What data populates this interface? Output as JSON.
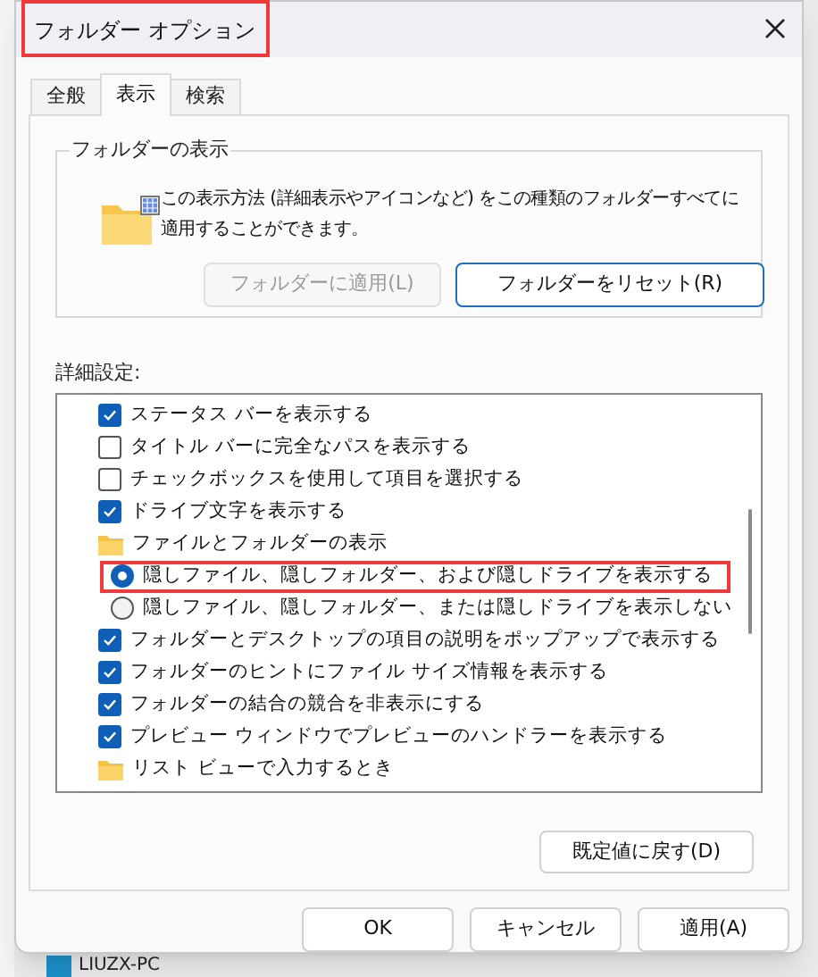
{
  "window": {
    "title": "フォルダー オプション"
  },
  "tabs": [
    {
      "label": "全般",
      "selected": false
    },
    {
      "label": "表示",
      "selected": true
    },
    {
      "label": "検索",
      "selected": false
    }
  ],
  "folder_views": {
    "title": "フォルダーの表示",
    "description": "この表示方法 (詳細表示やアイコンなど) をこの種類のフォルダーすべてに適用することができます。",
    "buttons": [
      {
        "label": "フォルダーに適用(L)",
        "disabled": true
      },
      {
        "label": "フォルダーをリセット(R)",
        "disabled": false
      }
    ]
  },
  "advanced": {
    "label": "詳細設定:",
    "items": [
      {
        "kind": "checkbox",
        "label": "ステータス バーを表示する",
        "checked": true
      },
      {
        "kind": "checkbox",
        "label": "タイトル バーに完全なパスを表示する",
        "checked": false
      },
      {
        "kind": "checkbox",
        "label": "チェックボックスを使用して項目を選択する",
        "checked": false
      },
      {
        "kind": "checkbox",
        "label": "ドライブ文字を表示する",
        "checked": true
      },
      {
        "kind": "folder",
        "label": "ファイルとフォルダーの表示",
        "children": [
          {
            "kind": "radio",
            "label": "隠しファイル、隠しフォルダー、および隠しドライブを表示する",
            "selected": true,
            "highlighted": true
          },
          {
            "kind": "radio",
            "label": "隠しファイル、隠しフォルダー、または隠しドライブを表示しない",
            "selected": false,
            "highlighted": false
          }
        ]
      },
      {
        "kind": "checkbox",
        "label": "フォルダーとデスクトップの項目の説明をポップアップで表示する",
        "checked": true
      },
      {
        "kind": "checkbox",
        "label": "フォルダーのヒントにファイル サイズ情報を表示する",
        "checked": true
      },
      {
        "kind": "checkbox",
        "label": "フォルダーの結合の競合を非表示にする",
        "checked": true
      },
      {
        "kind": "checkbox",
        "label": "プレビュー ウィンドウでプレビューのハンドラーを表示する",
        "checked": true
      },
      {
        "kind": "folder",
        "label": "リスト ビューで入力するとき"
      }
    ],
    "restore_button": "既定値に戻す(D)"
  },
  "buttons": [
    "OK",
    "キャンセル",
    "適用(A)"
  ],
  "background": {
    "computer_label": "LIUZX-PC"
  }
}
